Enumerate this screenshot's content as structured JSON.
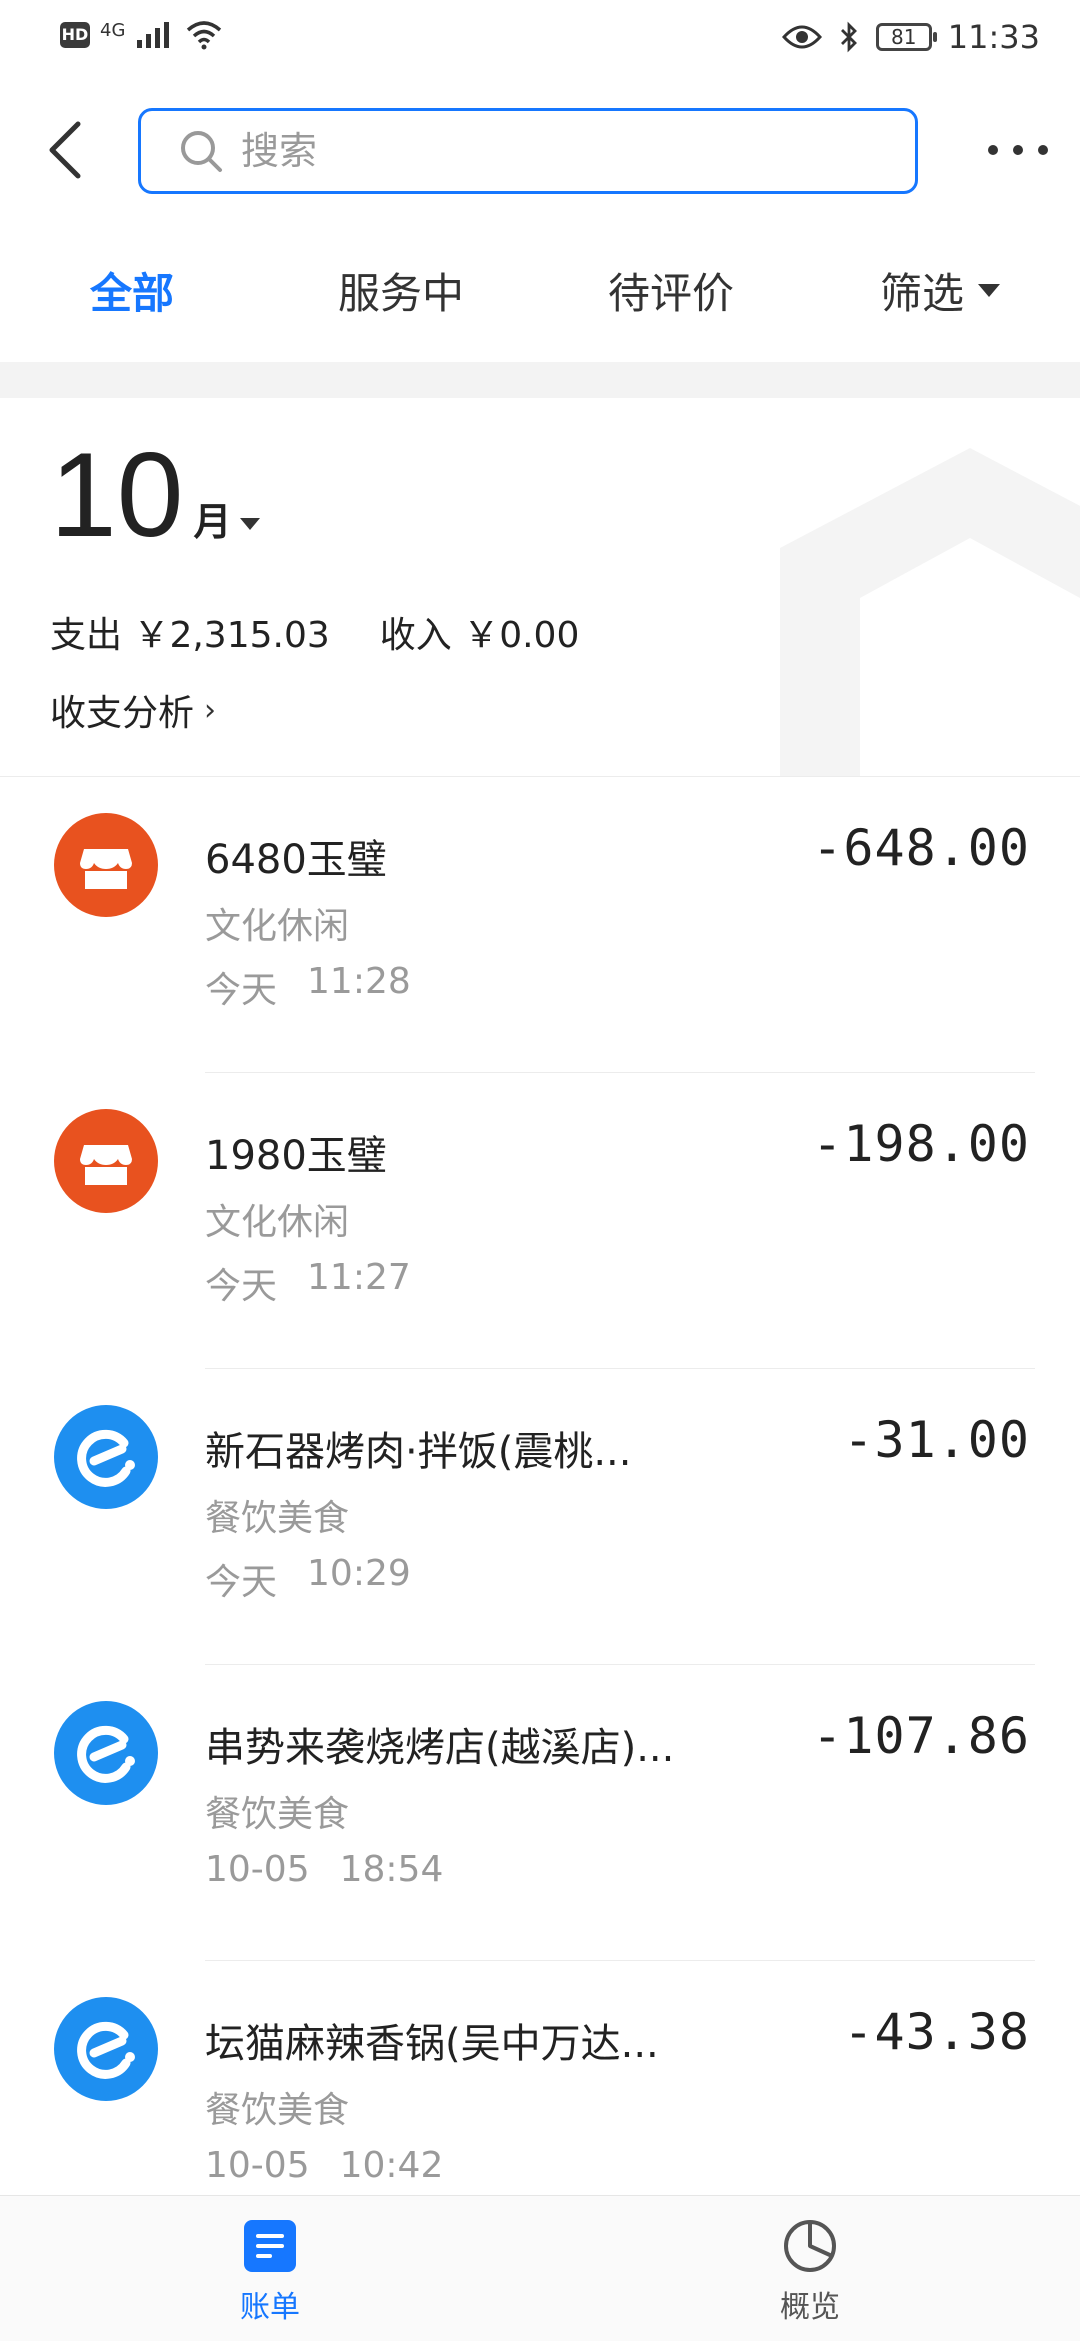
{
  "status_bar": {
    "hd": "HD",
    "network": "4G",
    "battery": "81",
    "time": "11:33"
  },
  "header": {
    "search_placeholder": "搜索"
  },
  "tabs": [
    {
      "label": "全部",
      "active": true
    },
    {
      "label": "服务中",
      "active": false
    },
    {
      "label": "待评价",
      "active": false
    },
    {
      "label": "筛选",
      "active": false
    }
  ],
  "summary": {
    "month": "10",
    "month_unit": "月",
    "expense": "支出 ￥2,315.03",
    "income": "收入 ￥0.00",
    "analysis_label": "收支分析"
  },
  "transactions": [
    {
      "title": "6480玉璧",
      "category": "文化休闲",
      "day": "今天",
      "time": "11:28",
      "amount": "-648.00",
      "icon": "shop-icon"
    },
    {
      "title": "1980玉璧",
      "category": "文化休闲",
      "day": "今天",
      "time": "11:27",
      "amount": "-198.00",
      "icon": "shop-icon"
    },
    {
      "title": "新石器烤肉·拌饭(震桃...",
      "category": "餐饮美食",
      "day": "今天",
      "time": "10:29",
      "amount": "-31.00",
      "icon": "eleme-icon"
    },
    {
      "title": "串势来袭烧烤店(越溪店)...",
      "category": "餐饮美食",
      "day": "10-05",
      "time": "18:54",
      "amount": "-107.86",
      "icon": "eleme-icon"
    },
    {
      "title": "坛猫麻辣香锅(吴中万达...",
      "category": "餐饮美食",
      "day": "10-05",
      "time": "10:42",
      "amount": "-43.38",
      "icon": "eleme-icon"
    }
  ],
  "bottom_nav": [
    {
      "label": "账单",
      "active": true,
      "icon": "bill-icon"
    },
    {
      "label": "概览",
      "active": false,
      "icon": "pie-chart-icon"
    }
  ],
  "colors": {
    "accent": "#1677ff",
    "shop_icon_bg": "#e8521f",
    "eleme_icon_bg": "#1e8ff0"
  }
}
